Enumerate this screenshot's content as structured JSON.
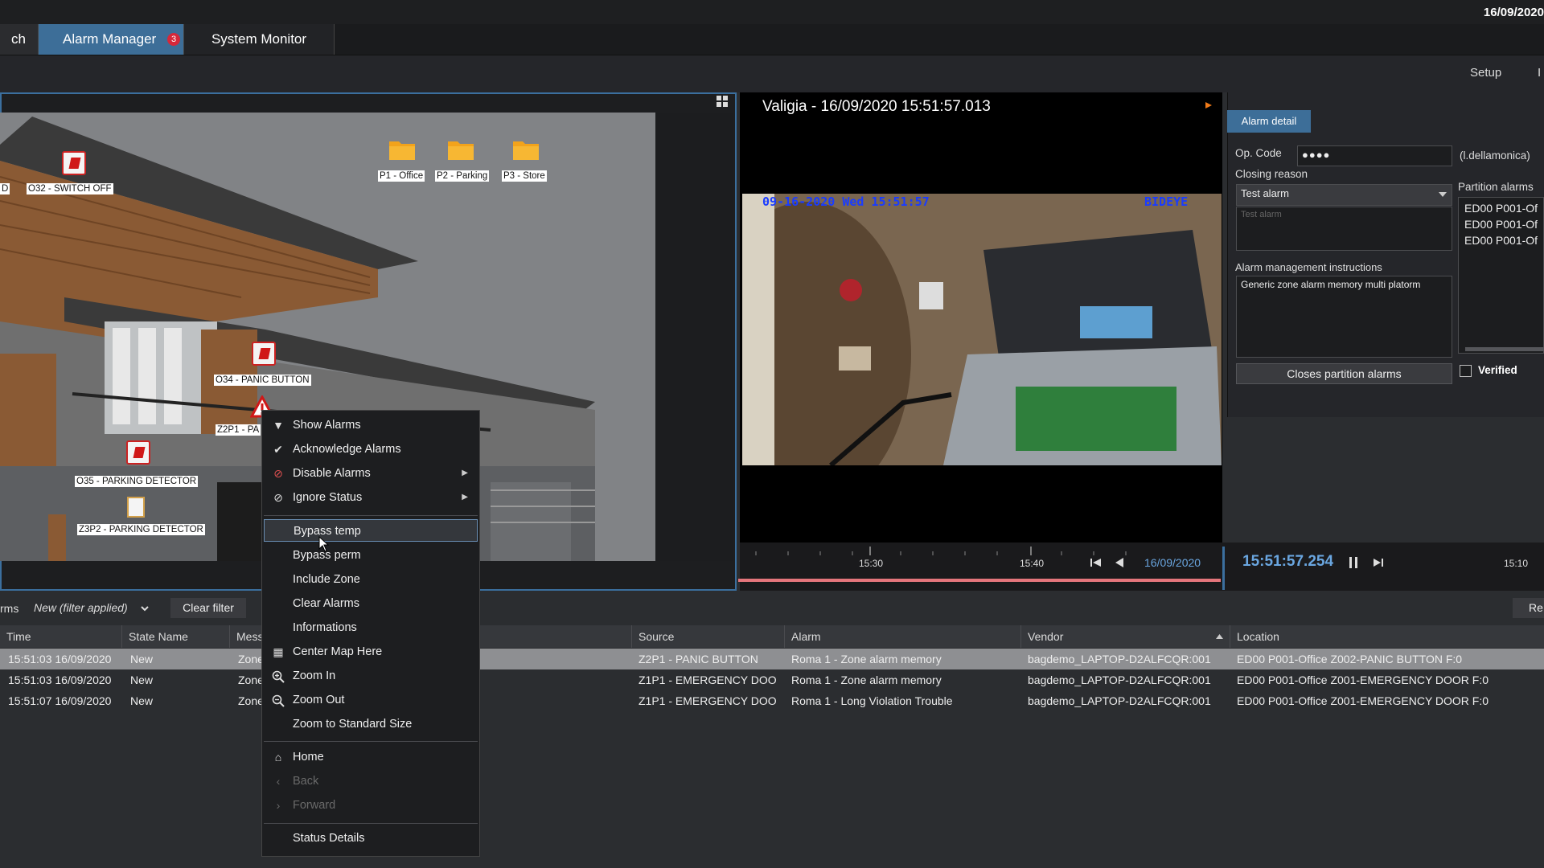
{
  "topbar": {
    "date": "16/09/2020"
  },
  "tabs": [
    {
      "label": "ch"
    },
    {
      "label": "Alarm Manager",
      "badge": "3"
    },
    {
      "label": "System Monitor"
    }
  ],
  "toolbar": {
    "setup": "Setup",
    "more": "I"
  },
  "map": {
    "folders": [
      "P1 - Office",
      "P2 - Parking",
      "P3 - Store"
    ],
    "labels": {
      "d": "D",
      "o32": "O32 - SWITCH OFF",
      "o34": "O34 - PANIC BUTTON",
      "z2p1": "Z2P1 - PA",
      "o35": "O35 - PARKING DETECTOR",
      "z3p2": "Z3P2 - PARKING DETECTOR"
    }
  },
  "video": {
    "title": "Valigia - 16/09/2020 15:51:57.013",
    "osd_time": "09-16-2020 Wed 15:51:57",
    "osd_brand": "BIDEYE",
    "timeline": {
      "ticks": [
        "15:30",
        "15:40",
        "15:10"
      ],
      "date": "16/09/2020",
      "time": "15:51:57.254"
    }
  },
  "detail": {
    "tab": "Alarm detail",
    "op_code_label": "Op. Code",
    "op_code_value": "●●●●",
    "operator": "(l.dellamonica)",
    "closing_reason_label": "Closing reason",
    "closing_reason_value": "Test alarm",
    "closing_reason_text": "Test alarm",
    "partition_alarms_label": "Partition alarms",
    "partition_alarms": [
      "ED00 P001-Of",
      "ED00 P001-Of",
      "ED00 P001-Of"
    ],
    "instructions_label": "Alarm management instructions",
    "instructions_text": "Generic zone alarm memory multi platorm",
    "close_button": "Closes partition alarms",
    "verified_label": "Verified"
  },
  "filter": {
    "prefix": "rms",
    "value": "New (filter applied)",
    "clear": "Clear filter",
    "right_btn": "Re"
  },
  "table": {
    "headers": [
      "Time",
      "State Name",
      "Mess",
      "Source",
      "Alarm",
      "Vendor",
      "Location"
    ],
    "rows": [
      {
        "time": "15:51:03 16/09/2020",
        "state": "New",
        "msg": "Zone",
        "source": "Z2P1 - PANIC BUTTON",
        "alarm": "Roma 1 - Zone alarm memory",
        "vendor": "bagdemo_LAPTOP-D2ALFCQR:001",
        "location": "ED00 P001-Office Z002-PANIC BUTTON F:0"
      },
      {
        "time": "15:51:03 16/09/2020",
        "state": "New",
        "msg": "Zone",
        "source": "Z1P1 - EMERGENCY DOO",
        "alarm": "Roma 1 - Zone alarm memory",
        "vendor": "bagdemo_LAPTOP-D2ALFCQR:001",
        "location": "ED00 P001-Office Z001-EMERGENCY DOOR F:0"
      },
      {
        "time": "15:51:07 16/09/2020",
        "state": "New",
        "msg": "Zone",
        "source": "Z1P1 - EMERGENCY DOO",
        "alarm": "Roma 1 - Long Violation Trouble",
        "vendor": "bagdemo_LAPTOP-D2ALFCQR:001",
        "location": "ED00 P001-Office Z001-EMERGENCY DOOR F:0"
      }
    ]
  },
  "context_menu": {
    "show_alarms": "Show Alarms",
    "acknowledge": "Acknowledge Alarms",
    "disable": "Disable Alarms",
    "ignore": "Ignore Status",
    "bypass_temp": "Bypass temp",
    "bypass_perm": "Bypass perm",
    "include_zone": "Include Zone",
    "clear_alarms": "Clear Alarms",
    "informations": "Informations",
    "center_map": "Center Map Here",
    "zoom_in": "Zoom In",
    "zoom_out": "Zoom Out",
    "zoom_std": "Zoom to Standard Size",
    "home": "Home",
    "back": "Back",
    "forward": "Forward",
    "status_details": "Status Details"
  },
  "colors": {
    "accent": "#3d6e98",
    "badge": "#d6283a",
    "timeline_time": "#6aa6e0"
  }
}
